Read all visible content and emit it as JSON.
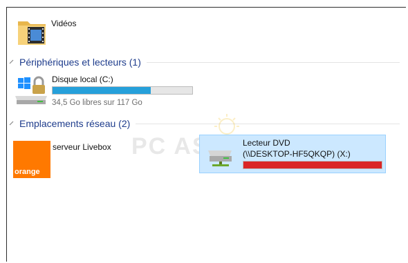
{
  "top_item": {
    "label": "Vidéos",
    "icon": "video-folder-icon"
  },
  "groups": {
    "devices": {
      "title": "Périphériques et lecteurs (1)"
    },
    "network": {
      "title": "Emplacements réseau (2)"
    }
  },
  "drives": [
    {
      "label": "Disque local (C:)",
      "free_text": "34,5 Go libres sur 117 Go",
      "used_fraction": 0.705,
      "bar_color": "#26a0da",
      "icon": "windows-drive-lock-icon"
    }
  ],
  "network_items": [
    {
      "label": "serveur Livebox",
      "icon": "orange-logo-icon",
      "logo_text": "orange",
      "logo_color": "#ff7900"
    },
    {
      "label_line1": "Lecteur DVD",
      "label_line2": "(\\\\DESKTOP-HF5QKQP) (X:)",
      "used_fraction": 1.0,
      "bar_color": "#da2626",
      "icon": "network-drive-icon",
      "selected": true
    }
  ],
  "watermark_text": "PC ASTU"
}
